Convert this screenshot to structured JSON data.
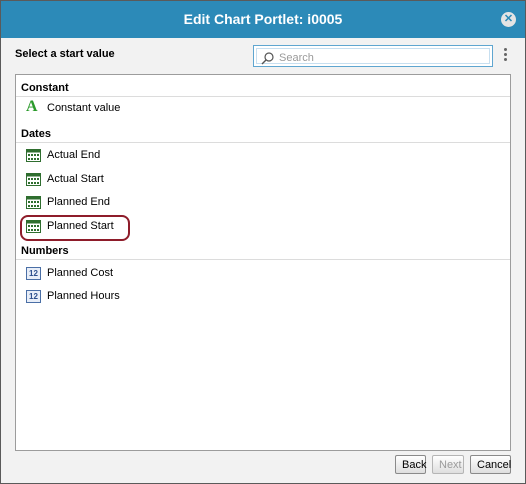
{
  "dialog": {
    "title": "Edit Chart Portlet: i0005",
    "close_icon": "close-icon"
  },
  "prompt": "Select a start value",
  "search": {
    "placeholder": "Search",
    "value": ""
  },
  "groups": [
    {
      "label": "Constant",
      "items": [
        {
          "label": "Constant value",
          "icon": "constant-icon"
        }
      ]
    },
    {
      "label": "Dates",
      "items": [
        {
          "label": "Actual End",
          "icon": "calendar-icon"
        },
        {
          "label": "Actual Start",
          "icon": "calendar-icon"
        },
        {
          "label": "Planned End",
          "icon": "calendar-icon"
        },
        {
          "label": "Planned Start",
          "icon": "calendar-icon",
          "highlighted": true
        }
      ]
    },
    {
      "label": "Numbers",
      "items": [
        {
          "label": "Planned Cost",
          "icon": "number-icon",
          "icon_text": "12"
        },
        {
          "label": "Planned Hours",
          "icon": "number-icon",
          "icon_text": "12"
        }
      ]
    }
  ],
  "footer": {
    "back": "Back",
    "next": "Next",
    "cancel": "Cancel",
    "next_disabled": true
  },
  "colors": {
    "titlebar": "#2c8ab8",
    "highlight_ring": "#8e1c2a",
    "constant_icon": "#2a9a2a"
  }
}
